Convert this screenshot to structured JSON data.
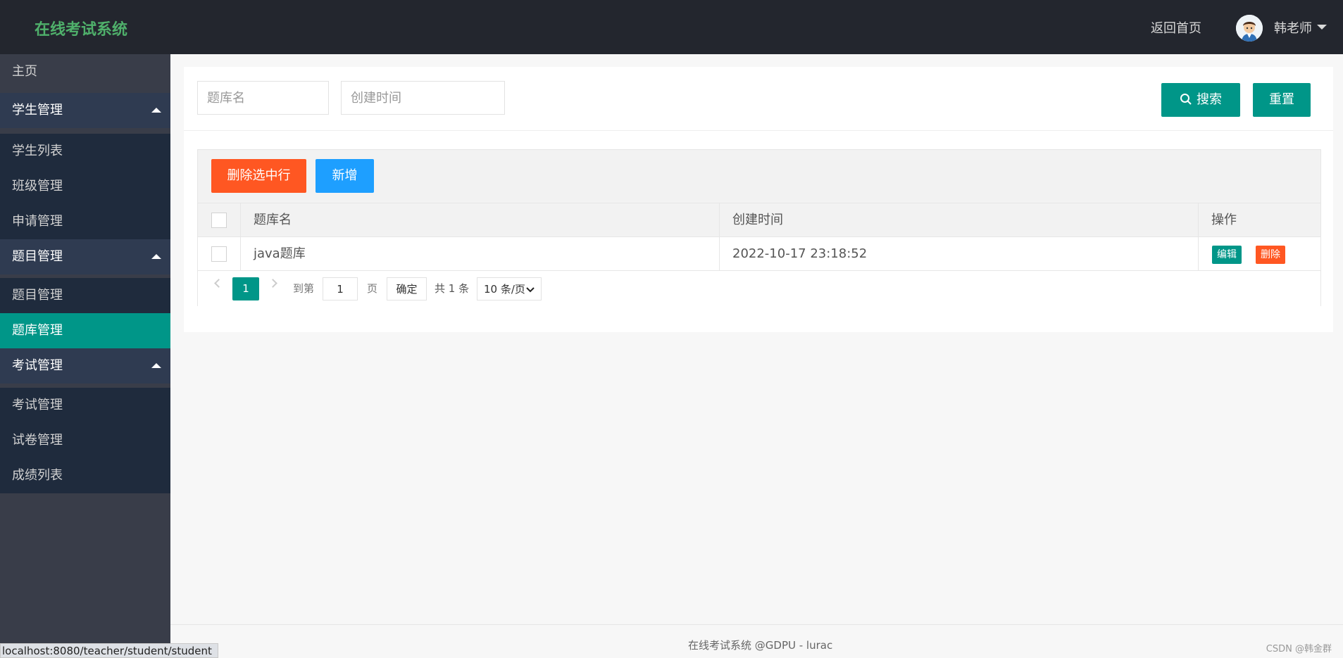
{
  "header": {
    "logo": "在线考试系统",
    "home_link": "返回首页",
    "user_name": "韩老师"
  },
  "sidebar": {
    "items": [
      {
        "label": "主页",
        "type": "item"
      },
      {
        "label": "学生管理",
        "type": "group"
      },
      {
        "label": "学生列表",
        "type": "sub"
      },
      {
        "label": "班级管理",
        "type": "sub"
      },
      {
        "label": "申请管理",
        "type": "sub"
      },
      {
        "label": "题目管理",
        "type": "group"
      },
      {
        "label": "题目管理",
        "type": "sub"
      },
      {
        "label": "题库管理",
        "type": "sub",
        "active": true
      },
      {
        "label": "考试管理",
        "type": "group"
      },
      {
        "label": "考试管理",
        "type": "sub"
      },
      {
        "label": "试卷管理",
        "type": "sub"
      },
      {
        "label": "成绩列表",
        "type": "sub"
      }
    ]
  },
  "search": {
    "bank_name_placeholder": "题库名",
    "created_time_placeholder": "创建时间",
    "search_label": "搜索",
    "reset_label": "重置"
  },
  "toolbar": {
    "delete_selected_label": "删除选中行",
    "add_label": "新增"
  },
  "table": {
    "columns": [
      "题库名",
      "创建时间",
      "操作"
    ],
    "rows": [
      {
        "name": "java题库",
        "created": "2022-10-17 23:18:52",
        "edit_label": "编辑",
        "delete_label": "删除"
      }
    ]
  },
  "pager": {
    "current_page": "1",
    "goto_label": "到第",
    "goto_value": "1",
    "page_suffix": "页",
    "confirm_label": "确定",
    "total_label": "共 1 条",
    "page_size_label": "10 条/页"
  },
  "footer": {
    "text": "在线考试系统 @GDPU - lurac",
    "watermark": "CSDN @韩金群"
  },
  "status_bar": {
    "url": "localhost:8080/teacher/student/student"
  },
  "colors": {
    "header_bg": "#23262e",
    "sidebar_bg": "#393d49",
    "accent": "#009688",
    "danger": "#ff5722",
    "primary": "#1e9fff",
    "logo": "#4fb06b"
  }
}
